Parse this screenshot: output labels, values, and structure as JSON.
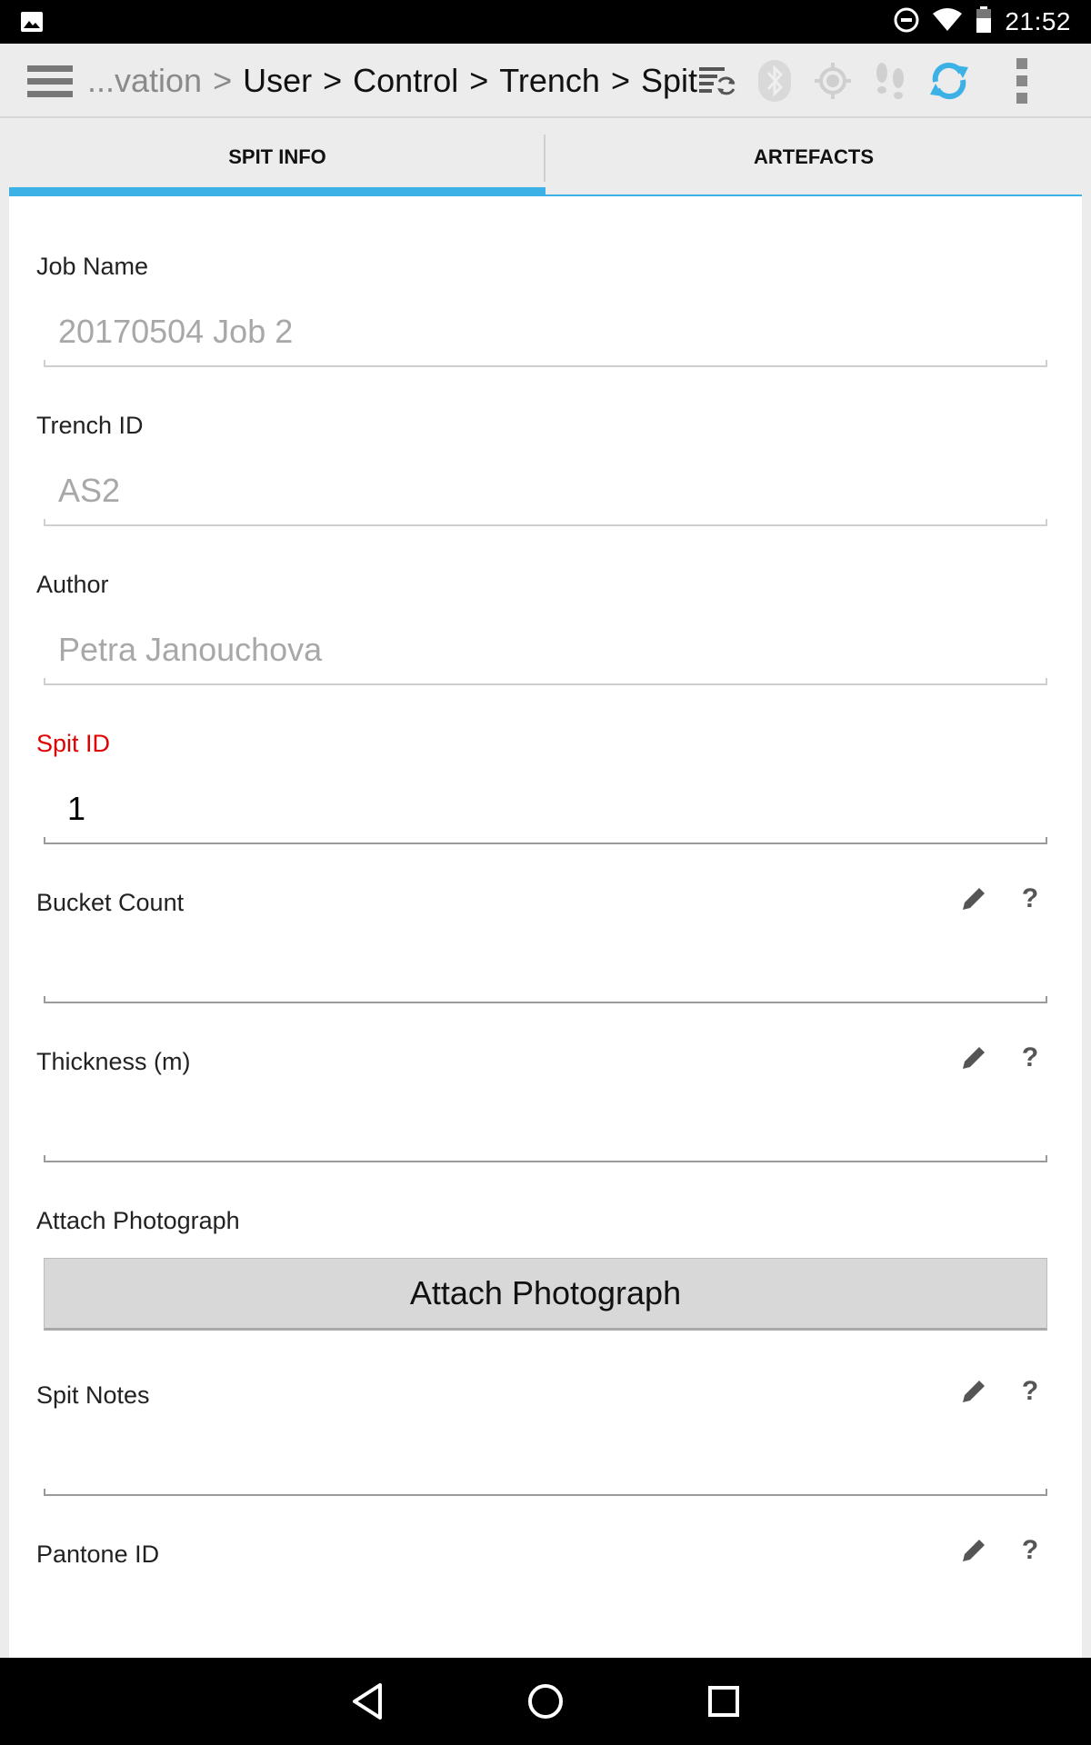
{
  "status_bar": {
    "time": "21:52",
    "icons": [
      "image-icon",
      "do-not-disturb-icon",
      "wifi-icon",
      "battery-icon"
    ]
  },
  "action_bar": {
    "breadcrumb": {
      "muted_prefix": "...vation",
      "items": [
        "User",
        "Control",
        "Trench",
        "Spit"
      ],
      "separator": ">"
    },
    "icons": [
      "menu-icon",
      "sync-list-icon",
      "bluetooth-icon",
      "gps-icon",
      "tracking-icon",
      "sync-icon",
      "overflow-menu-icon"
    ],
    "accent_color": "#3bb1e6"
  },
  "tabs": [
    {
      "label": "SPIT INFO",
      "active": true
    },
    {
      "label": "ARTEFACTS",
      "active": false
    }
  ],
  "form": {
    "job_name": {
      "label": "Job Name",
      "value": "20170504 Job 2"
    },
    "trench_id": {
      "label": "Trench ID",
      "value": "AS2"
    },
    "author": {
      "label": "Author",
      "value": "Petra Janouchova"
    },
    "spit_id": {
      "label": "Spit ID",
      "value": "1",
      "required_color": "#e00000"
    },
    "bucket_count": {
      "label": "Bucket Count",
      "value": "",
      "help": "?"
    },
    "thickness": {
      "label": "Thickness (m)",
      "value": "",
      "help": "?"
    },
    "attach_photo": {
      "label": "Attach Photograph",
      "button_label": "Attach Photograph"
    },
    "spit_notes": {
      "label": "Spit Notes",
      "value": "",
      "help": "?"
    },
    "pantone_id": {
      "label": "Pantone ID",
      "value": "",
      "help": "?"
    }
  },
  "nav_bar": {
    "icons": [
      "back-icon",
      "home-icon",
      "recents-icon"
    ]
  }
}
